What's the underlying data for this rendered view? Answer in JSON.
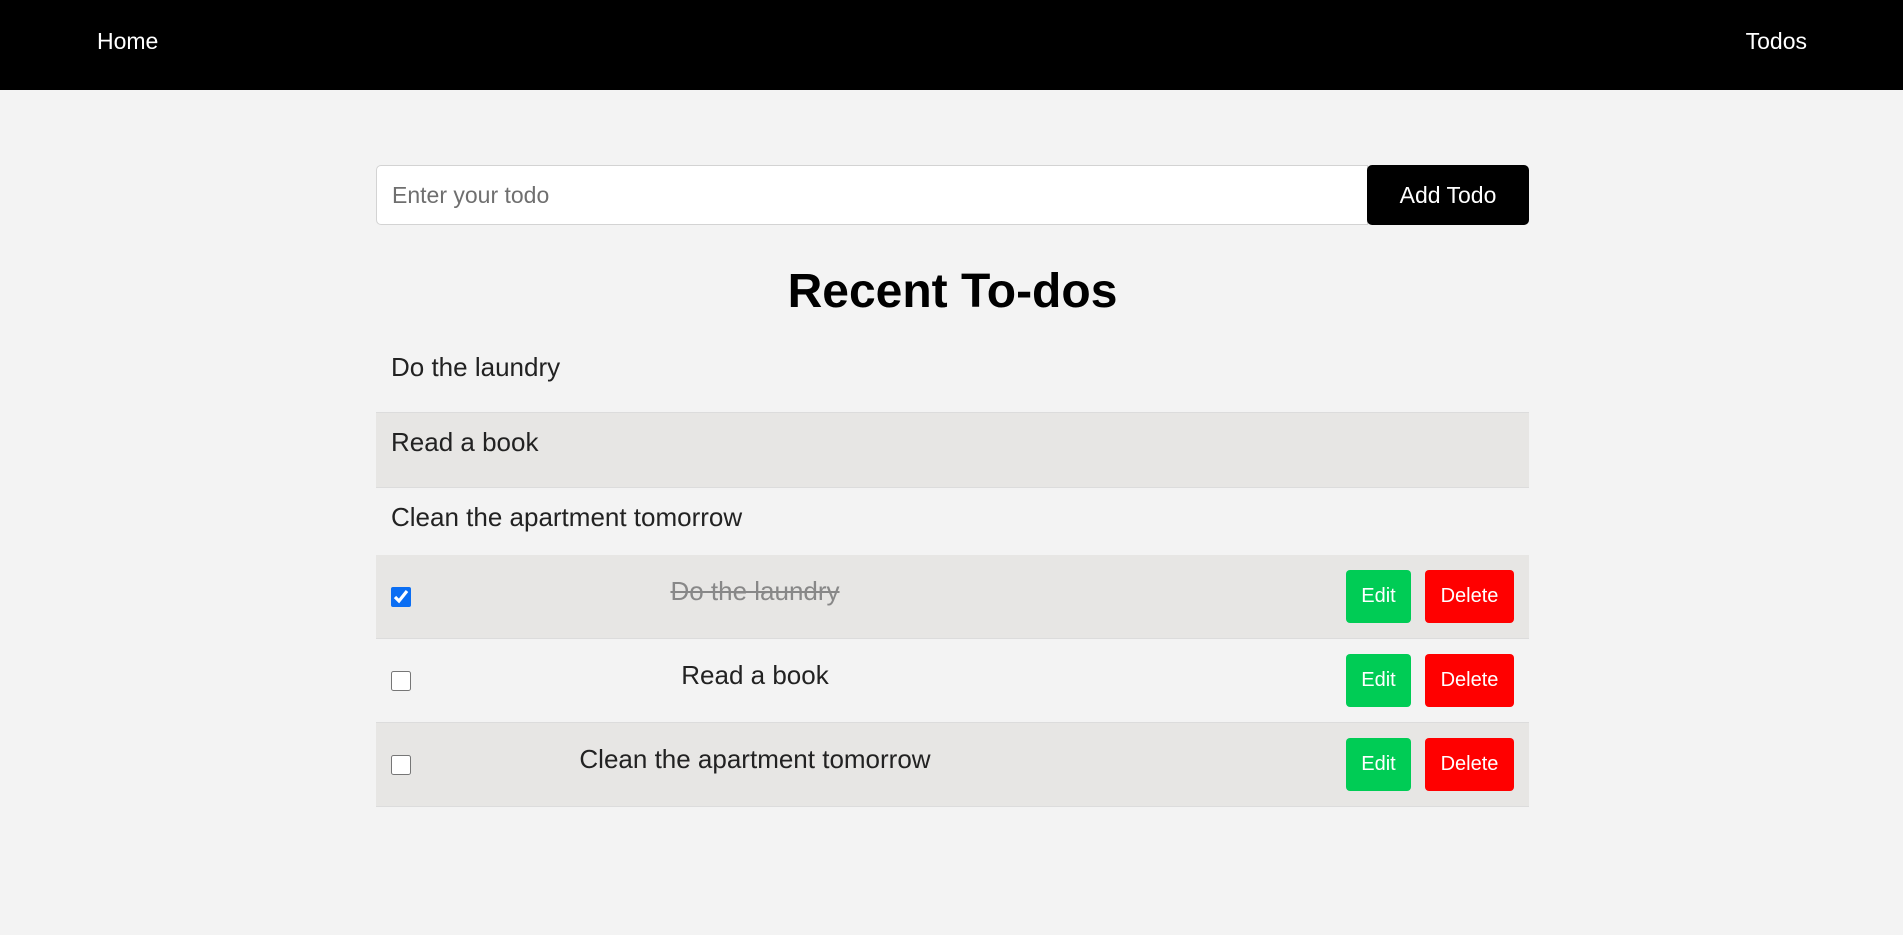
{
  "nav": {
    "home_label": "Home",
    "todos_label": "Todos"
  },
  "form": {
    "input_placeholder": "Enter your todo",
    "input_value": "",
    "add_label": "Add Todo"
  },
  "recent": {
    "title": "Recent To-dos",
    "items": [
      "Do the laundry",
      "Read a book",
      "Clean the apartment tomorrow"
    ]
  },
  "todos": [
    {
      "text": "Do the laundry",
      "checked": true,
      "edit_label": "Edit",
      "delete_label": "Delete"
    },
    {
      "text": "Read a book",
      "checked": false,
      "edit_label": "Edit",
      "delete_label": "Delete"
    },
    {
      "text": "Clean the apartment tomorrow",
      "checked": false,
      "edit_label": "Edit",
      "delete_label": "Delete"
    }
  ],
  "colors": {
    "nav_bg": "#000000",
    "edit": "#00cc55",
    "delete": "#ff0000",
    "row_alt": "#e7e6e4",
    "page_bg": "#f3f3f3"
  }
}
